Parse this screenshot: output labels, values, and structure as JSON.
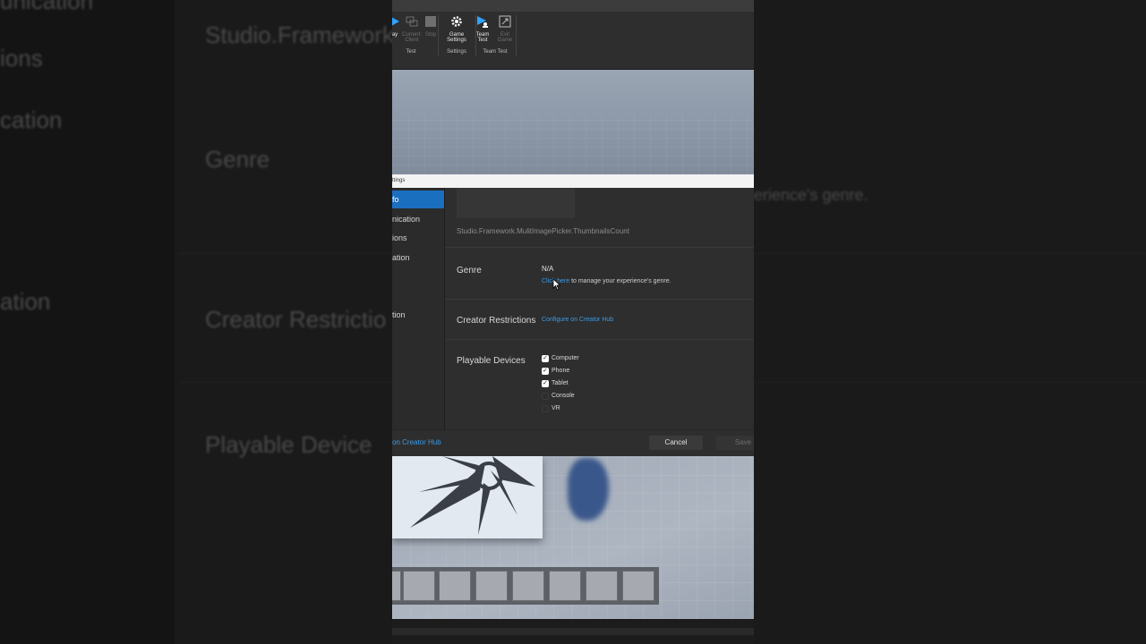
{
  "background_text": {
    "left_items": [
      "unication",
      "ions",
      "cation",
      "",
      "ation"
    ],
    "right_items": [
      "Studio.Framework",
      "Genre",
      "Creator Restrictio",
      "Playable Device"
    ],
    "far_right": "erience's genre."
  },
  "ribbon": {
    "buttons": [
      {
        "label": "ay",
        "icon": "play-icon",
        "disabled": false
      },
      {
        "label": "Current: Client",
        "icon": "current-client-icon",
        "disabled": true
      },
      {
        "label": "Stop",
        "icon": "stop-icon",
        "disabled": true
      },
      {
        "label": "Game Settings",
        "icon": "gear-icon",
        "disabled": false
      },
      {
        "label": "Team Test",
        "icon": "team-test-icon",
        "disabled": false
      },
      {
        "label": "Exit Game",
        "icon": "exit-game-icon",
        "disabled": true
      }
    ],
    "groups": [
      "Test",
      "Settings",
      "Team Test"
    ]
  },
  "dialog": {
    "title": "ttings",
    "sidebar": {
      "items": [
        "fo",
        "nication",
        "ions",
        "ation",
        "",
        "tion"
      ],
      "active_index": 0
    },
    "thumbnails_count_label": "Studio.Framework.MulitImagePicker.ThumbnailsCount",
    "genre": {
      "label": "Genre",
      "value": "N/A",
      "link_text": "Click here",
      "link_suffix": " to manage your experience's genre."
    },
    "creator_restrictions": {
      "label": "Creator Restrictions",
      "link_text": "Configure on Creator Hub"
    },
    "playable_devices": {
      "label": "Playable Devices",
      "options": [
        {
          "name": "Computer",
          "checked": true
        },
        {
          "name": "Phone",
          "checked": true
        },
        {
          "name": "Tablet",
          "checked": true
        },
        {
          "name": "Console",
          "checked": false
        },
        {
          "name": "VR",
          "checked": false
        }
      ]
    },
    "footer": {
      "creator_hub_link": "on Creator Hub",
      "cancel_label": "Cancel",
      "save_label": "Save"
    }
  },
  "colors": {
    "accent": "#1a6fbf",
    "link": "#3a9be6",
    "panel": "#2e2e2e"
  }
}
